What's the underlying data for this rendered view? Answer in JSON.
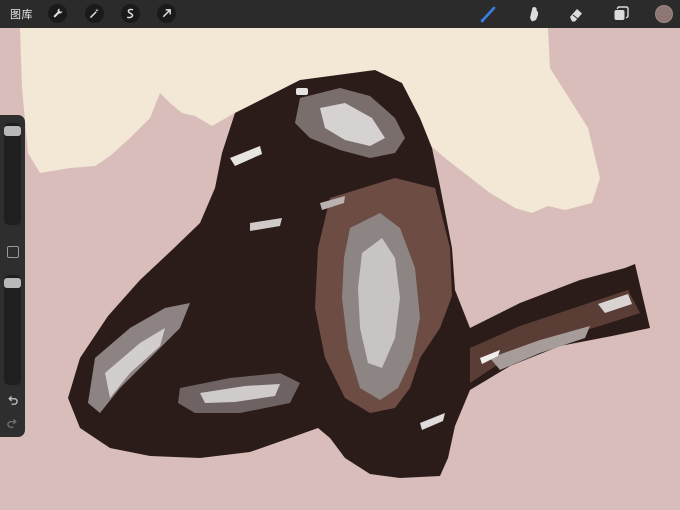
{
  "toolbar": {
    "gallery_label": "图库",
    "left_tools": [
      "wrench-icon",
      "magic-wand-icon",
      "selection-icon",
      "transform-arrow-icon"
    ],
    "right_tools": [
      "brush-icon",
      "smudge-icon",
      "eraser-icon",
      "layers-icon"
    ],
    "active_tool": "brush-icon",
    "active_color": "#8e7672",
    "accent_color": "#3a7fe8"
  },
  "sidebar": {
    "brush_size_level": 0.06,
    "opacity_level": 0.06,
    "undo_icon": "undo-icon",
    "redo_icon": "redo-icon",
    "modify_icon": "square-modify-icon"
  },
  "canvas": {
    "background_color": "#d9bdba",
    "torso_color": "#f3e7d6",
    "leather_color": "#2b1c1a"
  }
}
